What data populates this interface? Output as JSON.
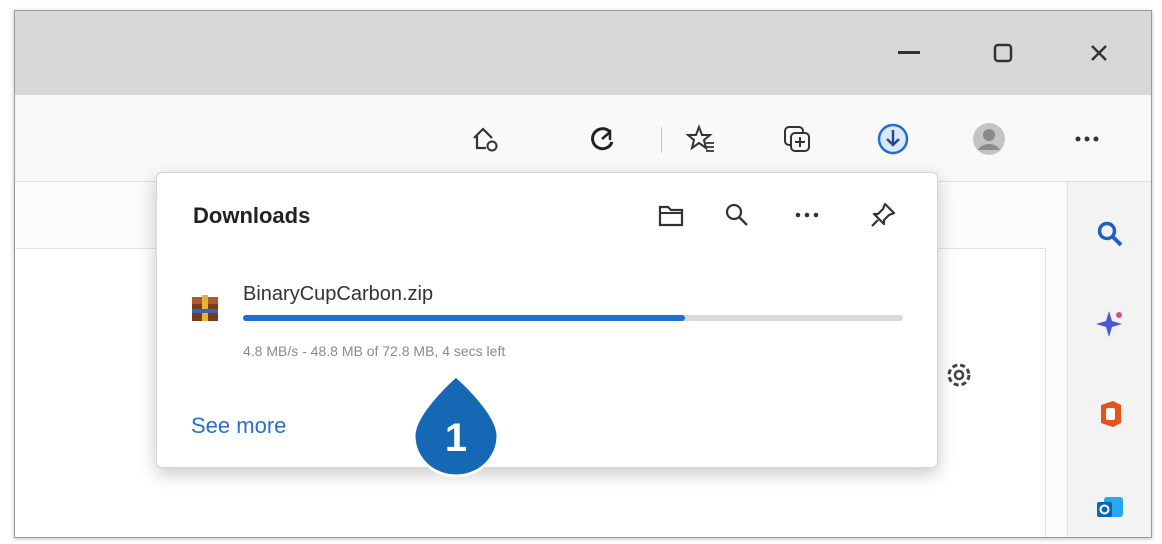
{
  "window": {
    "minimize_icon": "minimize-icon",
    "maximize_icon": "maximize-icon",
    "close_icon": "close-icon"
  },
  "toolbar": {
    "icons": [
      "home-settings-icon",
      "copilot-icon",
      "favorites-icon",
      "collections-icon",
      "downloads-icon",
      "profile-avatar",
      "more-icon"
    ]
  },
  "sidebar": {
    "icons": [
      "search-icon",
      "copilot-sparkle-icon",
      "office-icon",
      "outlook-icon"
    ]
  },
  "downloads_panel": {
    "title": "Downloads",
    "actions": [
      "open-folder-icon",
      "search-icon",
      "more-options-icon",
      "pin-icon"
    ],
    "item": {
      "file_name": "BinaryCupCarbon.zip",
      "progress_percent": 67,
      "status": "4.8 MB/s - 48.8 MB of 72.8 MB, 4 secs left"
    },
    "see_more": "See more"
  },
  "callout": {
    "number": "1"
  },
  "colors": {
    "accent": "#1f6fd1",
    "callout": "#1468b4",
    "titlebar": "#d8d8d8"
  }
}
